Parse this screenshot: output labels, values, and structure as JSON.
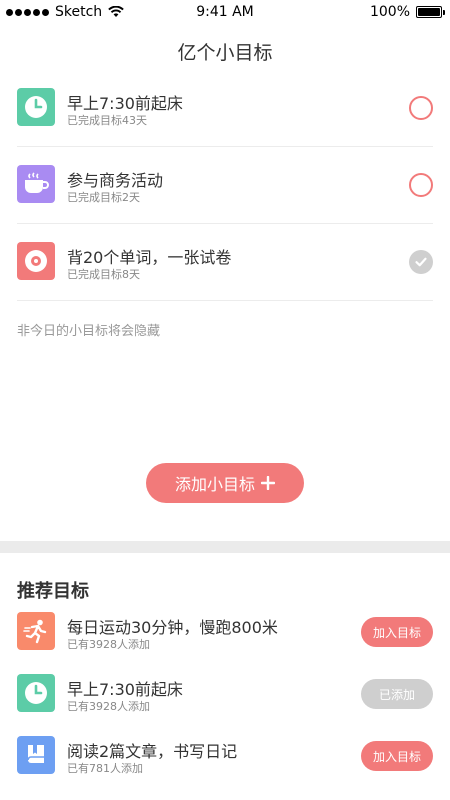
{
  "status_bar": {
    "carrier": "Sketch",
    "time": "9:41 AM",
    "battery": "100%",
    "battery_level": 1.0
  },
  "header": {
    "title": "亿个小目标"
  },
  "goals": [
    {
      "icon": "clock-icon",
      "color": "#5ccca7",
      "title": "早上7:30前起床",
      "subtitle": "已完成目标43天",
      "done": false
    },
    {
      "icon": "coffee-cup-icon",
      "color": "#a98bf2",
      "title": "参与商务活动",
      "subtitle": "已完成目标2天",
      "done": false
    },
    {
      "icon": "record-disc-icon",
      "color": "#f27a7a",
      "title": "背20个单词，一张试卷",
      "subtitle": "已完成目标8天",
      "done": true
    }
  ],
  "hint": "非今日的小目标将会隐藏",
  "add_button": {
    "label": "添加小目标",
    "icon": "plus-icon"
  },
  "recommended": {
    "heading": "推荐目标",
    "items": [
      {
        "icon": "runner-icon",
        "color": "#f98a6b",
        "title": "每日运动30分钟，慢跑800米",
        "subtitle": "已有3928人添加",
        "button": "加入目标",
        "added": false
      },
      {
        "icon": "clock-icon",
        "color": "#5ccca7",
        "title": "早上7:30前起床",
        "subtitle": "已有3928人添加",
        "button": "已添加",
        "added": true
      },
      {
        "icon": "book-icon",
        "color": "#6d9ff2",
        "title": "阅读2篇文章，书写日记",
        "subtitle": "已有781人添加",
        "button": "加入目标",
        "added": false
      }
    ]
  },
  "colors": {
    "accent": "#f27a7a",
    "muted": "#cfcfcf"
  }
}
